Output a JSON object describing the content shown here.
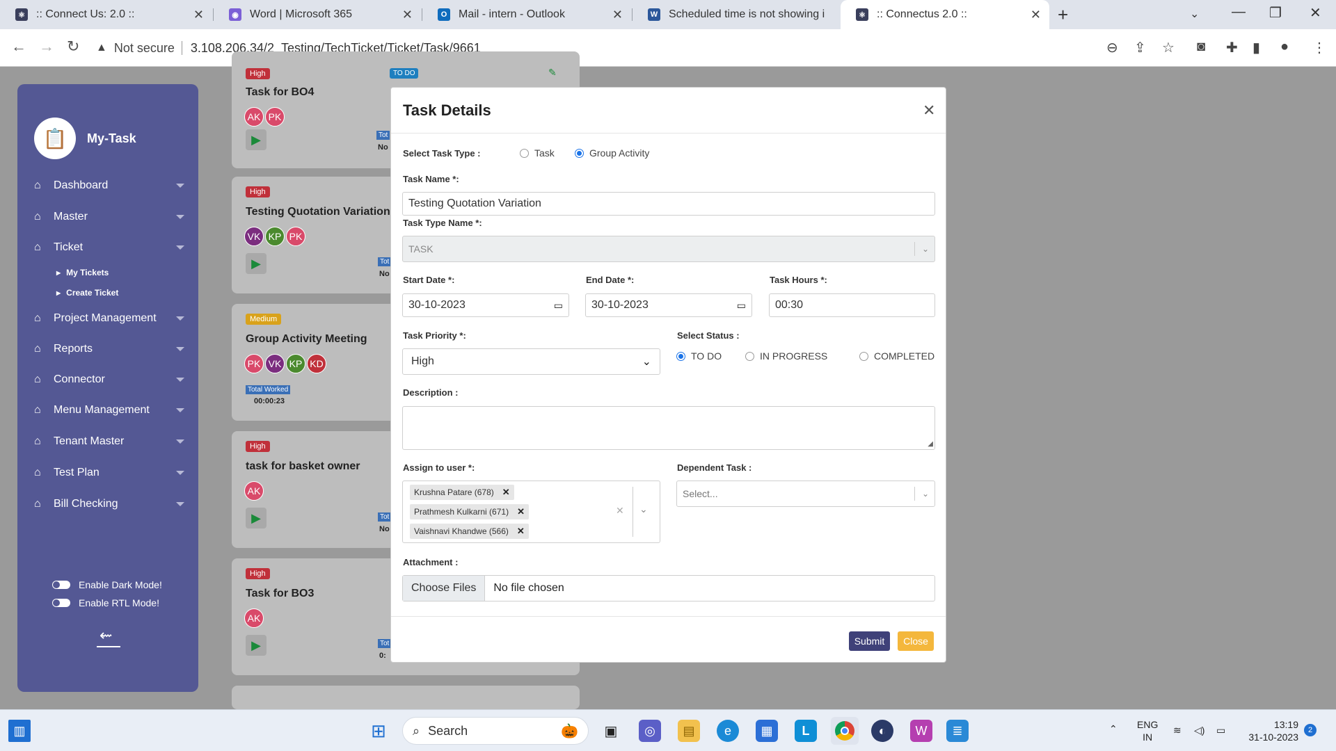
{
  "browser": {
    "tabs": [
      {
        "title": ":: Connect Us: 2.0 ::",
        "color": "#3a3f5c",
        "glyph": "⚛"
      },
      {
        "title": "Word | Microsoft 365",
        "color": "#7b5fd6",
        "glyph": "◉"
      },
      {
        "title": "Mail - intern - Outlook",
        "color": "#0f6cbd",
        "glyph": "O"
      },
      {
        "title": "Scheduled time is not showing i",
        "color": "#2b579a",
        "glyph": "W"
      },
      {
        "title": ":: Connectus 2.0 ::",
        "color": "#3a3f5c",
        "glyph": "⚛"
      }
    ],
    "security": "Not secure",
    "url": "3.108.206.34/2_Testing/TechTicket/Ticket/Task/9661"
  },
  "sidebar": {
    "brand": "My-Task",
    "items": [
      {
        "label": "Dashboard"
      },
      {
        "label": "Master"
      },
      {
        "label": "Ticket"
      },
      {
        "label": "Project Management"
      },
      {
        "label": "Reports"
      },
      {
        "label": "Connector"
      },
      {
        "label": "Menu Management"
      },
      {
        "label": "Tenant Master"
      },
      {
        "label": "Test Plan"
      },
      {
        "label": "Bill Checking"
      }
    ],
    "submenu": [
      {
        "label": "My Tickets"
      },
      {
        "label": "Create Ticket"
      }
    ],
    "dark_mode": "Enable Dark Mode!",
    "rtl_mode": "Enable RTL Mode!"
  },
  "cards": [
    {
      "priority": "High",
      "priority_color": "#c0303a",
      "title": "Task for BO4",
      "avatars": [
        "AK",
        "PK"
      ],
      "side_tag": "Tot",
      "side_no": "No"
    },
    {
      "priority": "High",
      "priority_color": "#c0303a",
      "title": "Testing Quotation Variation",
      "avatars": [
        "VK",
        "KP",
        "PK"
      ],
      "side_tag": "Tot",
      "side_no": "No"
    },
    {
      "priority": "Medium",
      "priority_color": "#d9a21b",
      "title": "Group Activity Meeting",
      "avatars": [
        "PK",
        "VK",
        "KP",
        "KD"
      ],
      "total_worked_label": "Total Worked",
      "total_worked": "00:00:23"
    },
    {
      "priority": "High",
      "priority_color": "#c0303a",
      "title": "task for basket owner",
      "avatars": [
        "AK"
      ],
      "side_tag": "Tot",
      "side_no": "No"
    },
    {
      "priority": "High",
      "priority_color": "#c0303a",
      "title": "Task for BO3",
      "avatars": [
        "AK"
      ],
      "side_tag": "Tot",
      "side_no": "0:"
    }
  ],
  "top_card_status": "TO DO",
  "modal": {
    "title": "Task Details",
    "task_type_label": "Select Task Type :",
    "task_type_options": [
      "Task",
      "Group Activity"
    ],
    "task_type_selected": "Group Activity",
    "task_name_label": "Task Name *:",
    "task_name_value": "Testing Quotation Variation",
    "task_type_name_label": "Task Type Name *:",
    "task_type_name_value": "TASK",
    "start_date_label": "Start Date *:",
    "start_date_value": "30-10-2023",
    "end_date_label": "End Date *:",
    "end_date_value": "30-10-2023",
    "task_hours_label": "Task Hours *:",
    "task_hours_value": "00:30",
    "priority_label": "Task Priority *:",
    "priority_value": "High",
    "status_label": "Select Status :",
    "status_options": [
      "TO DO",
      "IN PROGRESS",
      "COMPLETED"
    ],
    "status_selected": "TO DO",
    "description_label": "Description :",
    "description_value": "",
    "assign_label": "Assign to user *:",
    "assigned_users": [
      "Krushna Patare (678)",
      "Prathmesh Kulkarni (671)",
      "Vaishnavi Khandwe (566)"
    ],
    "dependent_label": "Dependent Task :",
    "dependent_placeholder": "Select...",
    "attachment_label": "Attachment :",
    "choose_files": "Choose Files",
    "no_file": "No file chosen",
    "submit": "Submit",
    "close": "Close"
  },
  "taskbar": {
    "search": "Search",
    "lang1": "ENG",
    "lang2": "IN",
    "time": "13:19",
    "date": "31-10-2023",
    "notifications": "2"
  },
  "colors": {
    "sidebar": "#545894",
    "submit": "#3f4179",
    "close": "#f4b73c",
    "accent": "#1a73e8"
  }
}
